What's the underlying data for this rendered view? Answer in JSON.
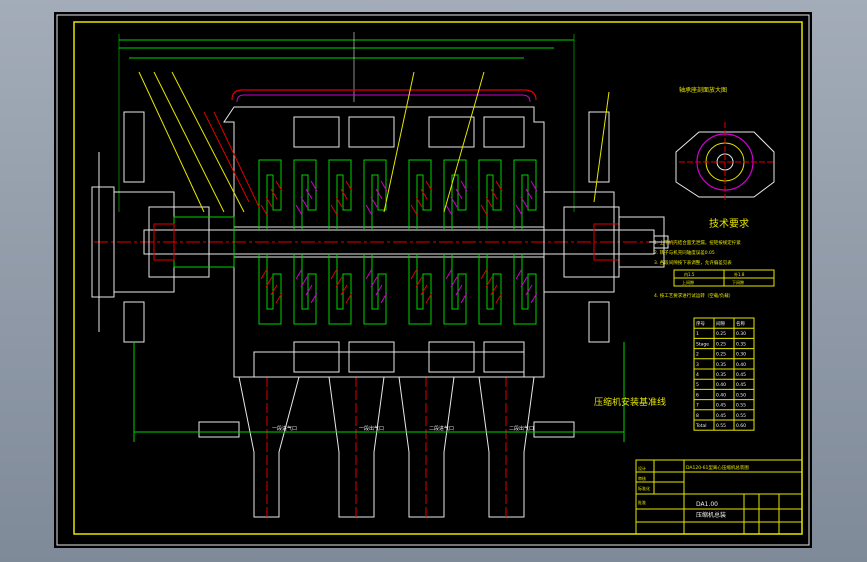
{
  "drawing": {
    "view_label": "压缩机安装基准线",
    "detail_title": "轴承座剖面放大图",
    "tech_requirements": {
      "heading": "技术要求",
      "items": [
        "1. 上下机壳结合面无泄漏，扭矩按规定拧紧",
        "2. 转子与机壳同轴度误差0.05",
        "3. 各段间隙按下表调整，允许偏差见表"
      ],
      "note": "4. 按工艺要求进行试运转（空载/负载）",
      "mini_table": [
        "内1.5",
        "外1.8",
        "上间隙",
        "下间隙"
      ]
    },
    "outlet_labels": [
      "一段进气口",
      "一段出气口",
      "二段进气口",
      "二段出气口"
    ],
    "clearance_table": {
      "rows": [
        [
          "序号",
          "间隙",
          "名称"
        ],
        [
          "1",
          "0.25",
          "0.30"
        ],
        [
          "Stage",
          "0.25",
          "0.35"
        ],
        [
          "2",
          "0.25",
          "0.30"
        ],
        [
          "3",
          "0.35",
          "0.40"
        ],
        [
          "4",
          "0.35",
          "0.45"
        ],
        [
          "5",
          "0.40",
          "0.45"
        ],
        [
          "6",
          "0.40",
          "0.50"
        ],
        [
          "7",
          "0.45",
          "0.55"
        ],
        [
          "8",
          "0.45",
          "0.55"
        ],
        [
          "Total",
          "0.55",
          "0.60"
        ]
      ]
    },
    "title_block": {
      "project": "DA120-61型离心压缩机总装图",
      "drawing_no": "DA1.00",
      "drawing_name": "压缩机总装",
      "labels": [
        "设计",
        "审核",
        "标准化",
        "批准"
      ]
    }
  },
  "colors": {
    "background": "#000000",
    "frame": "#e6e600",
    "outline": "#e8e8e8",
    "centerline": "#e00000",
    "hatch": "#00d200",
    "accent": "#d000d0"
  }
}
